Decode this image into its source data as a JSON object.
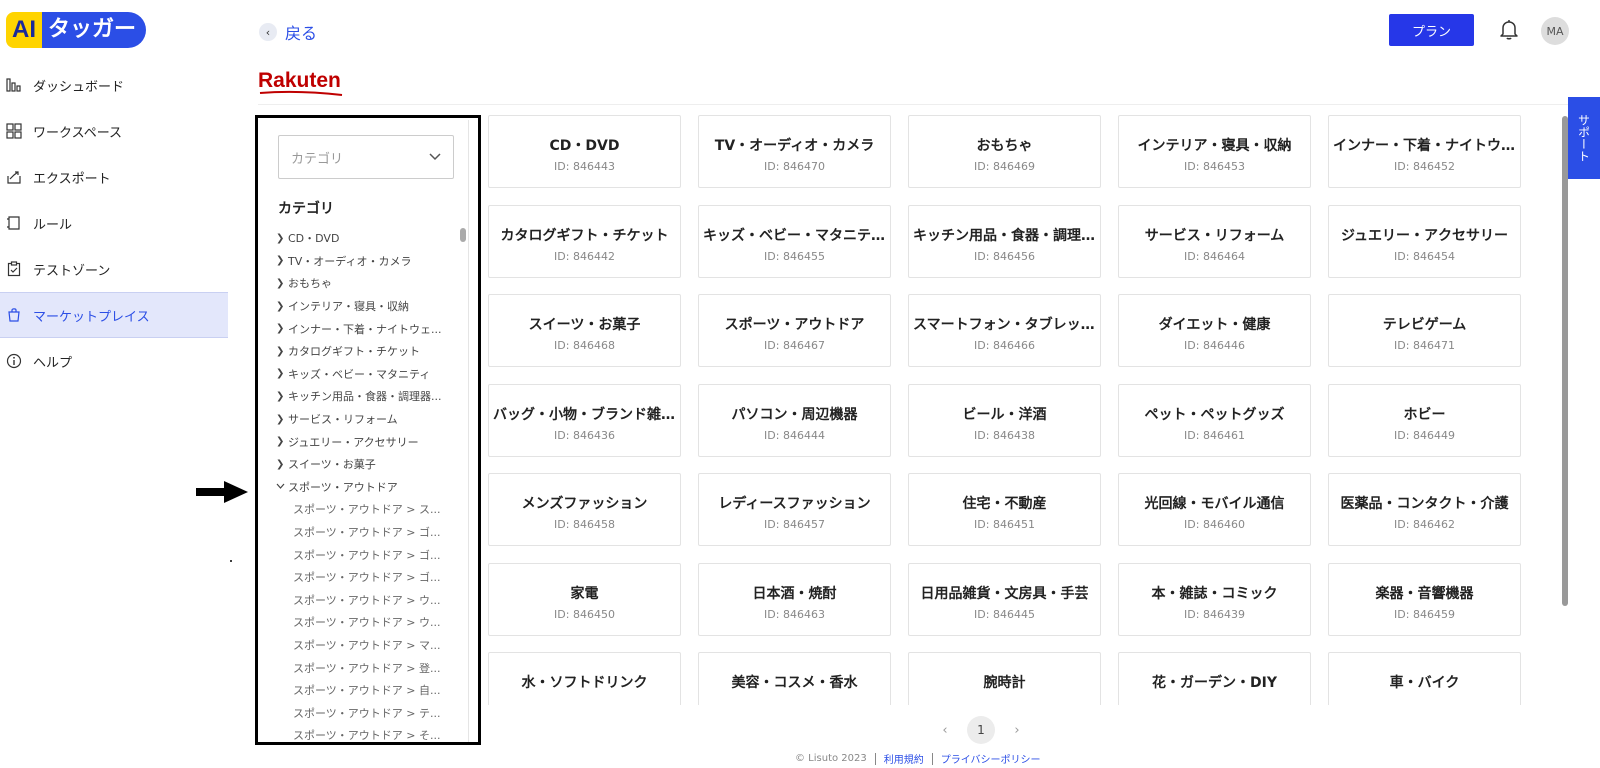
{
  "logo": {
    "ai": "AI",
    "text": "タッガー"
  },
  "nav": [
    {
      "label": "ダッシュボード",
      "icon": "chart-icon",
      "active": false
    },
    {
      "label": "ワークスペース",
      "icon": "grid-icon",
      "active": false
    },
    {
      "label": "エクスポート",
      "icon": "export-icon",
      "active": false
    },
    {
      "label": "ルール",
      "icon": "rule-icon",
      "active": false
    },
    {
      "label": "テストゾーン",
      "icon": "clipboard-icon",
      "active": false
    },
    {
      "label": "マーケットプレイス",
      "icon": "marketplace-icon",
      "active": true
    },
    {
      "label": "ヘルプ",
      "icon": "info-icon",
      "active": false
    }
  ],
  "header": {
    "back_label": "戻る",
    "plan_label": "プラン",
    "avatar_initials": "MA"
  },
  "brand": {
    "name": "Rakuten",
    "color": "#bf0000"
  },
  "category_panel": {
    "select_placeholder": "カテゴリ",
    "heading": "カテゴリ",
    "items": [
      {
        "label": "CD・DVD",
        "type": "collapsed"
      },
      {
        "label": "TV・オーディオ・カメラ",
        "type": "collapsed"
      },
      {
        "label": "おもちゃ",
        "type": "collapsed"
      },
      {
        "label": "インテリア・寝具・収納",
        "type": "collapsed"
      },
      {
        "label": "インナー・下着・ナイトウェ...",
        "type": "collapsed"
      },
      {
        "label": "カタログギフト・チケット",
        "type": "collapsed"
      },
      {
        "label": "キッズ・ベビー・マタニティ",
        "type": "collapsed"
      },
      {
        "label": "キッチン用品・食器・調理器...",
        "type": "collapsed"
      },
      {
        "label": "サービス・リフォーム",
        "type": "collapsed"
      },
      {
        "label": "ジュエリー・アクセサリー",
        "type": "collapsed"
      },
      {
        "label": "スイーツ・お菓子",
        "type": "collapsed"
      },
      {
        "label": "スポーツ・アウトドア",
        "type": "expanded"
      },
      {
        "label": "スポーツ・アウトドア > ス...",
        "type": "sub"
      },
      {
        "label": "スポーツ・アウトドア > ゴ...",
        "type": "sub"
      },
      {
        "label": "スポーツ・アウトドア > ゴ...",
        "type": "sub"
      },
      {
        "label": "スポーツ・アウトドア > ゴ...",
        "type": "sub"
      },
      {
        "label": "スポーツ・アウトドア > ウ...",
        "type": "sub"
      },
      {
        "label": "スポーツ・アウトドア > ウ...",
        "type": "sub"
      },
      {
        "label": "スポーツ・アウトドア > マ...",
        "type": "sub"
      },
      {
        "label": "スポーツ・アウトドア > 登...",
        "type": "sub"
      },
      {
        "label": "スポーツ・アウトドア > 自...",
        "type": "sub"
      },
      {
        "label": "スポーツ・アウトドア > テ...",
        "type": "sub"
      },
      {
        "label": "スポーツ・アウトドア > そ...",
        "type": "sub"
      }
    ]
  },
  "cards": [
    {
      "name": "CD・DVD",
      "id": "ID: 846443"
    },
    {
      "name": "TV・オーディオ・カメラ",
      "id": "ID: 846470"
    },
    {
      "name": "おもちゃ",
      "id": "ID: 846469"
    },
    {
      "name": "インテリア・寝具・収納",
      "id": "ID: 846453"
    },
    {
      "name": "インナー・下着・ナイトウ...",
      "id": "ID: 846452"
    },
    {
      "name": "カタログギフト・チケット",
      "id": "ID: 846442"
    },
    {
      "name": "キッズ・ベビー・マタニテ...",
      "id": "ID: 846455"
    },
    {
      "name": "キッチン用品・食器・調理...",
      "id": "ID: 846456"
    },
    {
      "name": "サービス・リフォーム",
      "id": "ID: 846464"
    },
    {
      "name": "ジュエリー・アクセサリー",
      "id": "ID: 846454"
    },
    {
      "name": "スイーツ・お菓子",
      "id": "ID: 846468"
    },
    {
      "name": "スポーツ・アウトドア",
      "id": "ID: 846467"
    },
    {
      "name": "スマートフォン・タブレッ...",
      "id": "ID: 846466"
    },
    {
      "name": "ダイエット・健康",
      "id": "ID: 846446"
    },
    {
      "name": "テレビゲーム",
      "id": "ID: 846471"
    },
    {
      "name": "バッグ・小物・ブランド雑...",
      "id": "ID: 846436"
    },
    {
      "name": "パソコン・周辺機器",
      "id": "ID: 846444"
    },
    {
      "name": "ビール・洋酒",
      "id": "ID: 846438"
    },
    {
      "name": "ペット・ペットグッズ",
      "id": "ID: 846461"
    },
    {
      "name": "ホビー",
      "id": "ID: 846449"
    },
    {
      "name": "メンズファッション",
      "id": "ID: 846458"
    },
    {
      "name": "レディースファッション",
      "id": "ID: 846457"
    },
    {
      "name": "住宅・不動産",
      "id": "ID: 846451"
    },
    {
      "name": "光回線・モバイル通信",
      "id": "ID: 846460"
    },
    {
      "name": "医薬品・コンタクト・介護",
      "id": "ID: 846462"
    },
    {
      "name": "家電",
      "id": "ID: 846450"
    },
    {
      "name": "日本酒・焼酎",
      "id": "ID: 846463"
    },
    {
      "name": "日用品雑貨・文房具・手芸",
      "id": "ID: 846445"
    },
    {
      "name": "本・雑誌・コミック",
      "id": "ID: 846439"
    },
    {
      "name": "楽器・音響機器",
      "id": "ID: 846459"
    },
    {
      "name": "水・ソフトドリンク",
      "id": ""
    },
    {
      "name": "美容・コスメ・香水",
      "id": ""
    },
    {
      "name": "腕時計",
      "id": ""
    },
    {
      "name": "花・ガーデン・DIY",
      "id": ""
    },
    {
      "name": "車・バイク",
      "id": ""
    }
  ],
  "pagination": {
    "current": "1",
    "prev": "‹",
    "next": "›"
  },
  "support_label": "サポート",
  "footer": {
    "copyright": "© Lisuto 2023",
    "terms": "利用規約",
    "privacy": "プライバシーポリシー"
  },
  "colors": {
    "accent": "#2b4ee6",
    "plan_button": "#2637e8",
    "active_nav_bg": "#e3e7fb"
  }
}
